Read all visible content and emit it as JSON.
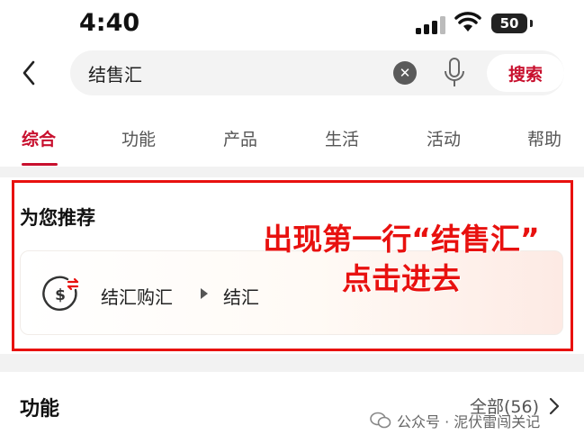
{
  "status_bar": {
    "time": "4:40",
    "battery": "50"
  },
  "search": {
    "query": "结售汇",
    "submit_label": "搜索"
  },
  "tabs": [
    {
      "label": "综合",
      "active": true
    },
    {
      "label": "功能",
      "active": false
    },
    {
      "label": "产品",
      "active": false
    },
    {
      "label": "生活",
      "active": false
    },
    {
      "label": "活动",
      "active": false
    },
    {
      "label": "帮助",
      "active": false
    }
  ],
  "recommend": {
    "title": "为您推荐",
    "path_parent": "结汇购汇",
    "path_child": "结汇"
  },
  "annotation": {
    "line1": "出现第一行“结售汇”",
    "line2": "点击进去"
  },
  "functions": {
    "title": "功能",
    "all_label": "全部(56)"
  },
  "watermark": {
    "text": "公众号 · 泥伏雷闯关记"
  },
  "colors": {
    "accent": "#c8102e",
    "annotation_red": "#e8110f"
  }
}
